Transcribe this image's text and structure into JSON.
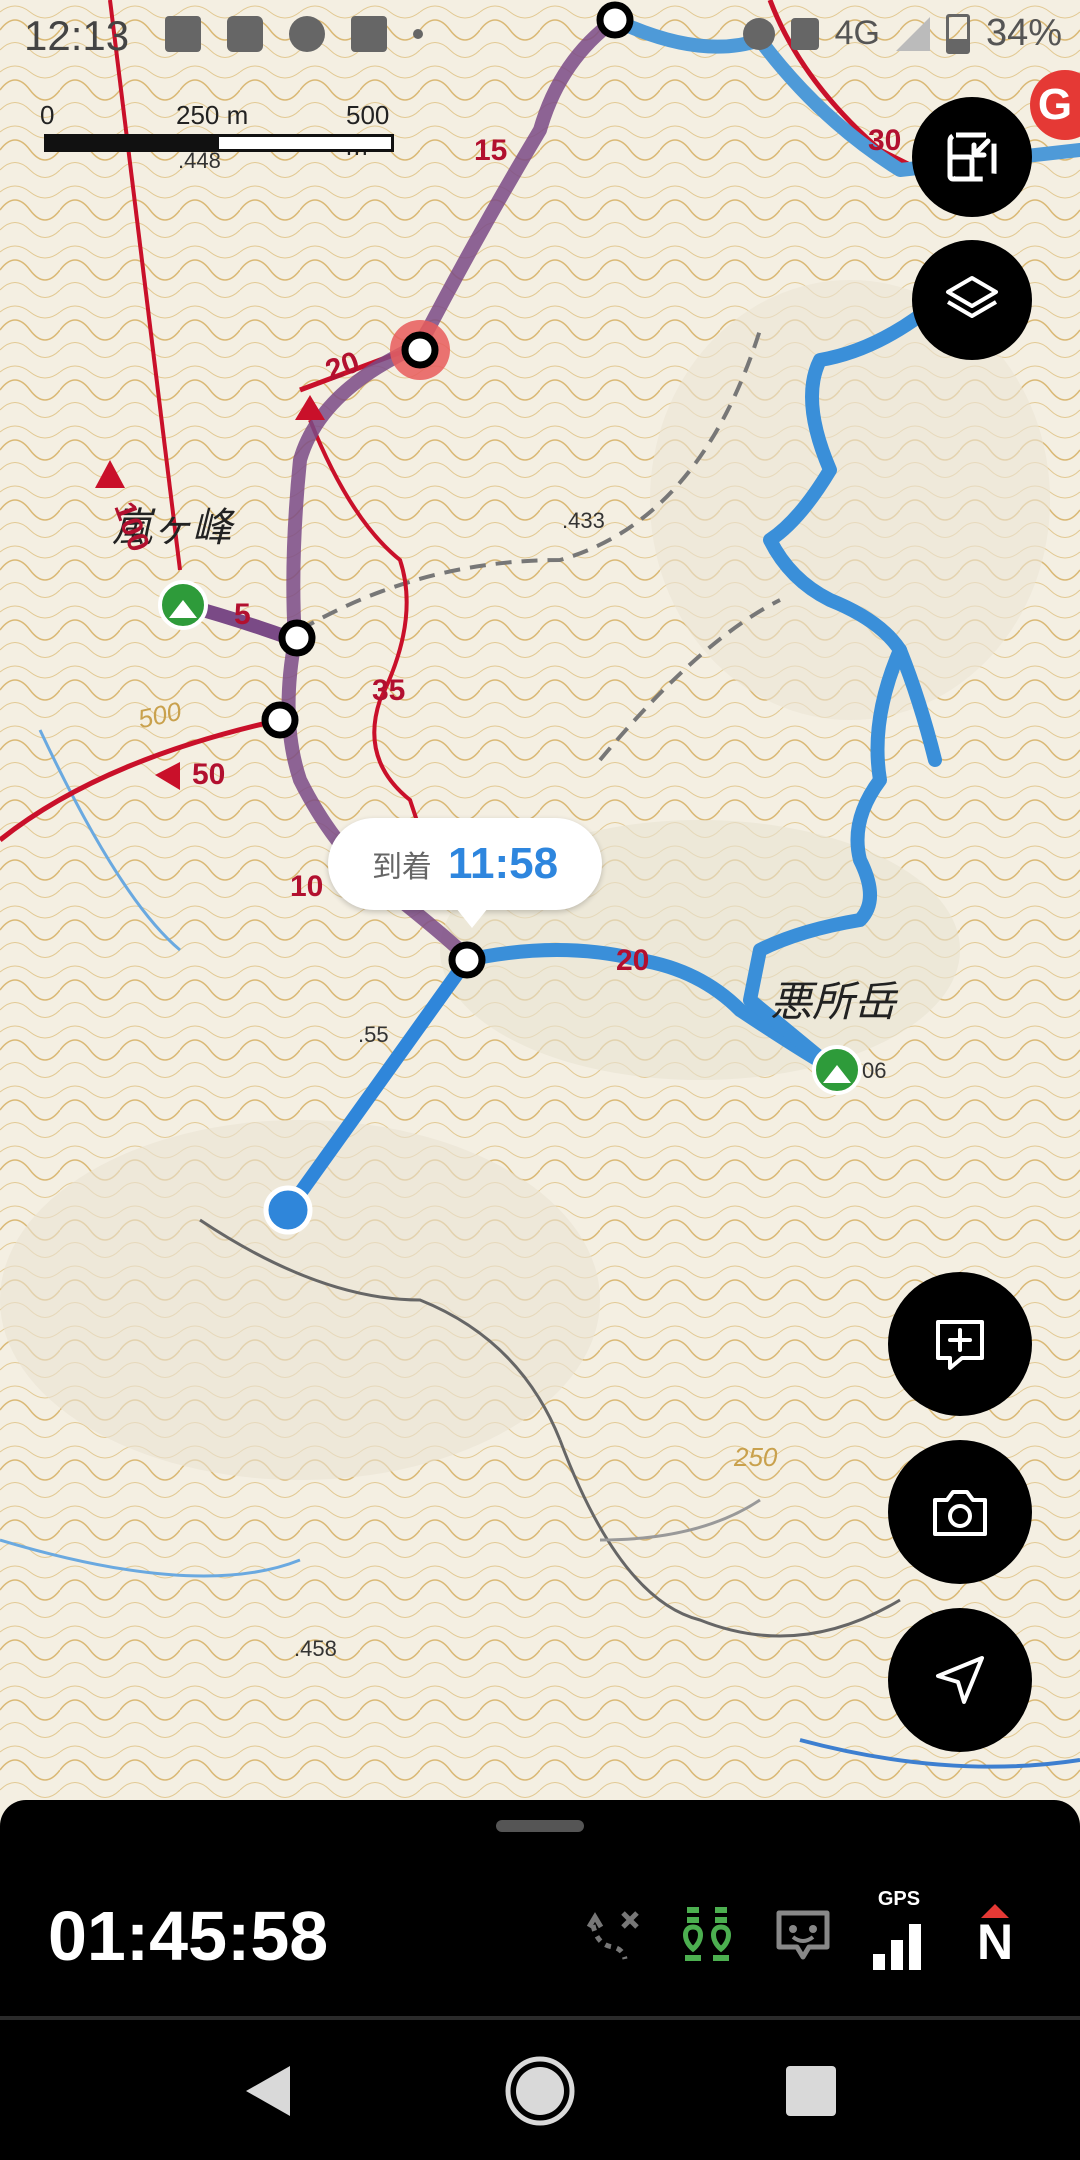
{
  "status_bar": {
    "time": "12:13",
    "network": "4G",
    "battery": "34%",
    "icons": [
      "image-icon",
      "my-au-icon",
      "brightness-icon",
      "qr-icon",
      "dot-icon",
      "alarm-icon",
      "key-icon",
      "signal-icon",
      "battery-icon"
    ]
  },
  "scale": {
    "label_0": "0",
    "label_mid": "250 m",
    "label_max": "500 m"
  },
  "map": {
    "peak_label_left": "嵐ヶ峰",
    "peak_label_right": "悪所岳",
    "elevations": [
      ".448",
      ".433",
      ".55",
      "06",
      ".458"
    ],
    "contour_labels": [
      "500",
      "250"
    ],
    "route_numbers": [
      "15",
      "30",
      "20",
      "100",
      "5",
      "35",
      "50",
      "10",
      "20"
    ],
    "goal_marker": "G"
  },
  "arrival": {
    "label": "到着",
    "time": "11:58"
  },
  "fabs": [
    "exit-fullscreen-icon",
    "layers-icon",
    "add-memo-icon",
    "camera-icon",
    "navigate-icon"
  ],
  "panel": {
    "elapsed_time": "01:45:58",
    "gps_label": "GPS",
    "compass_label": "N"
  },
  "nav": [
    "back",
    "home",
    "recents"
  ]
}
